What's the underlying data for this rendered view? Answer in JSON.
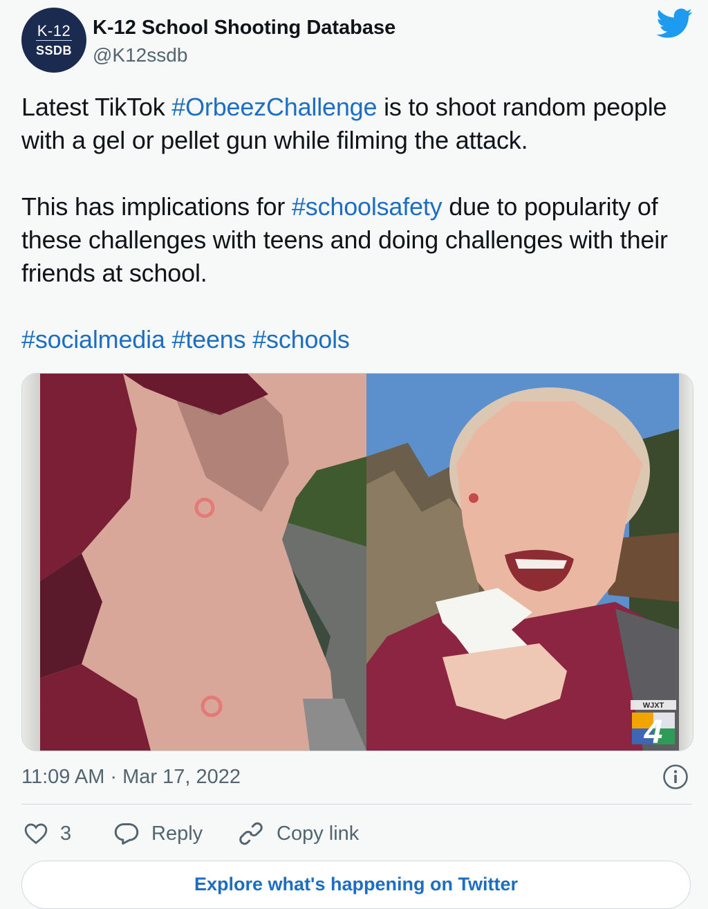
{
  "author": {
    "name": "K-12 School Shooting Database",
    "handle": "@K12ssdb",
    "avatar_line1": "K-12",
    "avatar_line2": "SSDB"
  },
  "tweet": {
    "p1_before": "Latest TikTok ",
    "p1_tag": "#OrbeezChallenge",
    "p1_after": " is to shoot random people with a gel or pellet gun while filming the attack.",
    "p2_before": "This has implications for ",
    "p2_tag": "#schoolsafety",
    "p2_after": " due to popularity of these challenges with teens and doing challenges with their friends at school.",
    "hashtags": [
      "#socialmedia",
      "#teens",
      "#schools"
    ]
  },
  "media": {
    "station_logo_text": "WJXT",
    "station_logo_number": "4"
  },
  "timestamp": "11:09 AM · Mar 17, 2022",
  "actions": {
    "likes": "3",
    "reply": "Reply",
    "copy_link": "Copy link"
  },
  "explore_label": "Explore what's happening on Twitter",
  "colors": {
    "link": "#1d6ec2",
    "twitter_blue": "#1d9bf0",
    "avatar_bg": "#1b2a4f",
    "secondary_text": "#536471"
  }
}
